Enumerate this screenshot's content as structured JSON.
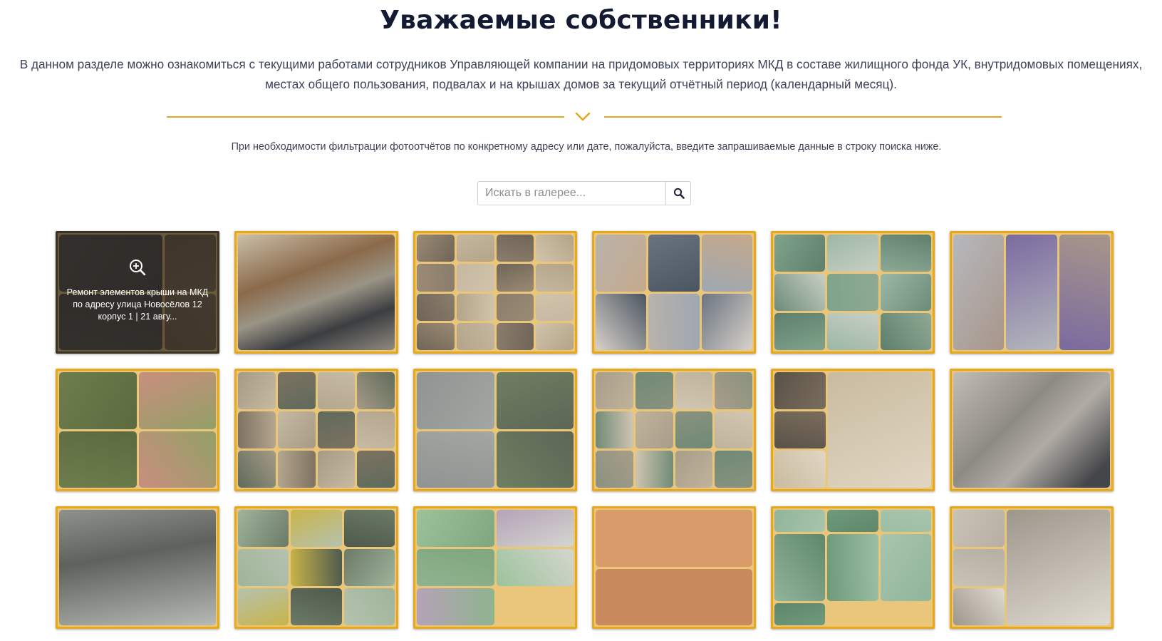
{
  "header": {
    "title": "Уважаемые собственники!",
    "intro_line1": "В данном разделе можно ознакомиться с текущими работами сотрудников Управляющей компании на придомовых территориях МКД в составе жилищного фонда УК, внутридомовых помещениях,",
    "intro_line2": "местах общего пользования, подвалах и на крышах домов за текущий отчётный период (календарный месяц)."
  },
  "hint": "При необходимости фильтрации фотоотчётов по конкретному адресу или дате, пожалуйста, введите запрашиваемые данные в строку поиска ниже.",
  "search": {
    "placeholder": "Искать в галерее...",
    "button_icon": "search-icon"
  },
  "colors": {
    "accent": "#e2a724",
    "title": "#151a33",
    "text": "#3d4259"
  },
  "gallery": {
    "hovered_caption": "Ремонт элементов крыши на МКД по адресу улица Новосёлов 12 корпус 1 | 21 авгу...",
    "hover_icon": "zoom-in-icon",
    "tile_count": 18
  }
}
